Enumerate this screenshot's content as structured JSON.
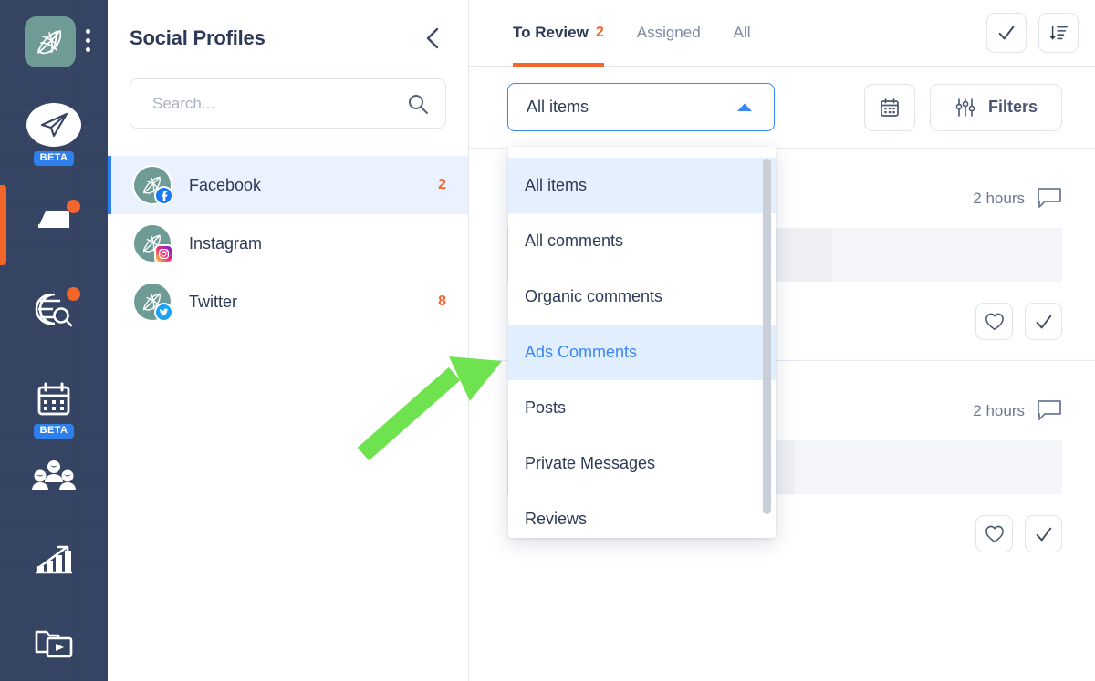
{
  "colors": {
    "rail_bg": "#364463",
    "accent_orange": "#f4652b",
    "accent_blue": "#2f80ed",
    "link_blue": "#3b86f7",
    "text_dark": "#2d3a57",
    "highlight_bg": "#e4f0fd",
    "logo_teal": "#6e9b95"
  },
  "rail": {
    "logo_icon": "leaf-globe-logo-icon",
    "kebab_icon": "kebab-menu-icon",
    "items": [
      {
        "icon": "paper-plane-icon",
        "badge": "BETA",
        "dot": false
      },
      {
        "icon": "inbox-icon",
        "badge": "",
        "dot": true
      },
      {
        "icon": "globe-search-icon",
        "badge": "",
        "dot": true
      },
      {
        "icon": "calendar-icon",
        "badge": "BETA",
        "dot": false
      },
      {
        "icon": "users-group-icon",
        "badge": "",
        "dot": false
      },
      {
        "icon": "analytics-growth-icon",
        "badge": "",
        "dot": false
      },
      {
        "icon": "video-folder-icon",
        "badge": "",
        "dot": false
      }
    ]
  },
  "profiles": {
    "title": "Social Profiles",
    "collapse_icon": "chevron-left-icon",
    "search": {
      "placeholder": "Search...",
      "value": "",
      "icon": "search-icon"
    },
    "items": [
      {
        "name": "Facebook",
        "network": "facebook",
        "count": "2",
        "active": true
      },
      {
        "name": "Instagram",
        "network": "instagram",
        "count": "",
        "active": false
      },
      {
        "name": "Twitter",
        "network": "twitter",
        "count": "8",
        "active": false
      }
    ]
  },
  "tabs": {
    "items": [
      {
        "label": "To Review",
        "badge": "2",
        "active": true
      },
      {
        "label": "Assigned",
        "badge": "",
        "active": false
      },
      {
        "label": "All",
        "badge": "",
        "active": false
      }
    ],
    "actions": [
      {
        "icon": "check-mark-icon"
      },
      {
        "icon": "sort-descending-icon"
      }
    ]
  },
  "filterbar": {
    "select": {
      "value": "All items",
      "chevron_icon": "chevron-up-icon",
      "open": true
    },
    "calendar_icon": "calendar-icon",
    "filters_label": "Filters",
    "filters_icon": "sliders-icon"
  },
  "dropdown": {
    "options": [
      {
        "label": "All items",
        "state": "selected"
      },
      {
        "label": "All comments",
        "state": "normal"
      },
      {
        "label": "Organic comments",
        "state": "normal"
      },
      {
        "label": "Ads Comments",
        "state": "highlight"
      },
      {
        "label": "Posts",
        "state": "normal"
      },
      {
        "label": "Private Messages",
        "state": "normal"
      },
      {
        "label": "Reviews",
        "state": "normal"
      }
    ]
  },
  "feed": {
    "rows": [
      {
        "time": "2 hours",
        "comment_icon": "comment-bubble-icon",
        "actions": [
          {
            "icon": "heart-icon"
          },
          {
            "icon": "check-mark-icon"
          }
        ]
      },
      {
        "time": "2 hours",
        "comment_icon": "comment-bubble-icon",
        "actions": [
          {
            "icon": "heart-icon"
          },
          {
            "icon": "check-mark-icon"
          }
        ]
      }
    ]
  },
  "annotation": {
    "type": "green-arrow",
    "color": "#6ee24f",
    "points_to": "Ads Comments"
  }
}
